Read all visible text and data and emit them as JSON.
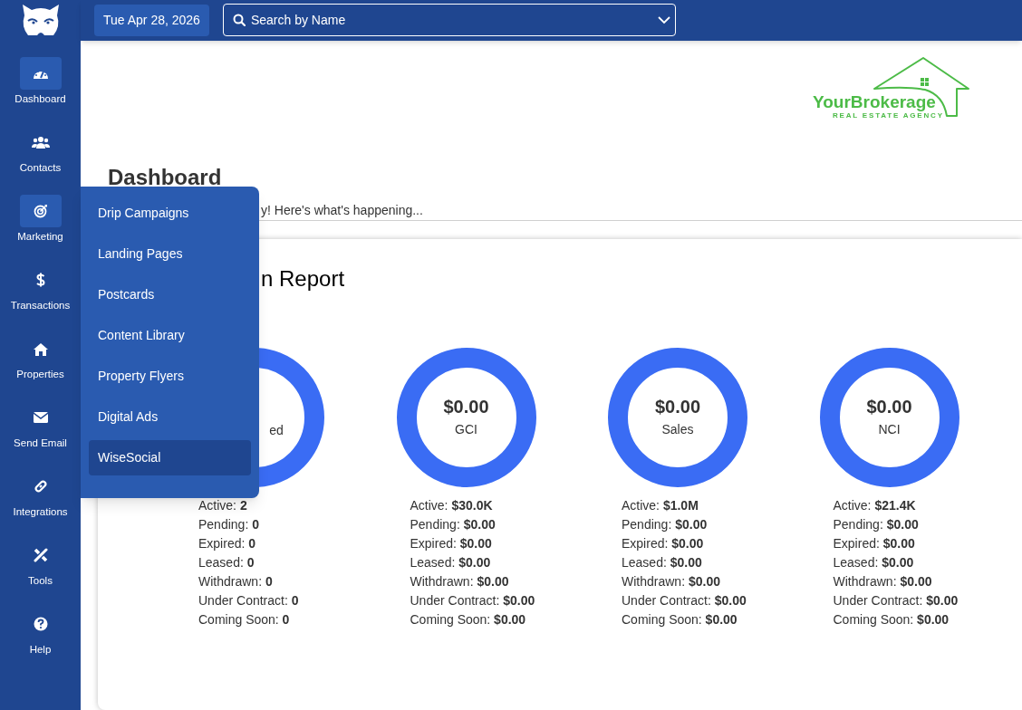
{
  "topbar": {
    "date": "Tue Apr 28, 2026",
    "search": {
      "placeholder": "Search by Name"
    }
  },
  "sidebar": {
    "items": [
      {
        "label": "Dashboard",
        "active": true
      },
      {
        "label": "Contacts",
        "active": false
      },
      {
        "label": "Marketing",
        "active": true
      },
      {
        "label": "Transactions",
        "active": false
      },
      {
        "label": "Properties",
        "active": false
      },
      {
        "label": "Send Email",
        "active": false
      },
      {
        "label": "Integrations",
        "active": false
      },
      {
        "label": "Tools",
        "active": false
      },
      {
        "label": "Help",
        "active": false
      }
    ]
  },
  "logo": {
    "name": "YourBrokerage",
    "tagline": "REAL ESTATE AGENCY"
  },
  "header": {
    "title": "Dashboard",
    "subtitle": "y! Here's what's happening..."
  },
  "report": {
    "title": "n Report",
    "cards": [
      {
        "label": "ed",
        "stats": [
          {
            "name": "Active:",
            "value": "2"
          },
          {
            "name": "Pending:",
            "value": "0"
          },
          {
            "name": "Expired:",
            "value": "0"
          },
          {
            "name": "Leased:",
            "value": "0"
          },
          {
            "name": "Withdrawn:",
            "value": "0"
          },
          {
            "name": "Under Contract:",
            "value": "0"
          },
          {
            "name": "Coming Soon:",
            "value": "0"
          }
        ]
      },
      {
        "value": "$0.00",
        "label": "GCI",
        "stats": [
          {
            "name": "Active:",
            "value": "$30.0K"
          },
          {
            "name": "Pending:",
            "value": "$0.00"
          },
          {
            "name": "Expired:",
            "value": "$0.00"
          },
          {
            "name": "Leased:",
            "value": "$0.00"
          },
          {
            "name": "Withdrawn:",
            "value": "$0.00"
          },
          {
            "name": "Under Contract:",
            "value": "$0.00"
          },
          {
            "name": "Coming Soon:",
            "value": "$0.00"
          }
        ]
      },
      {
        "value": "$0.00",
        "label": "Sales",
        "stats": [
          {
            "name": "Active:",
            "value": "$1.0M"
          },
          {
            "name": "Pending:",
            "value": "$0.00"
          },
          {
            "name": "Expired:",
            "value": "$0.00"
          },
          {
            "name": "Leased:",
            "value": "$0.00"
          },
          {
            "name": "Withdrawn:",
            "value": "$0.00"
          },
          {
            "name": "Under Contract:",
            "value": "$0.00"
          },
          {
            "name": "Coming Soon:",
            "value": "$0.00"
          }
        ]
      },
      {
        "value": "$0.00",
        "label": "NCI",
        "stats": [
          {
            "name": "Active:",
            "value": "$21.4K"
          },
          {
            "name": "Pending:",
            "value": "$0.00"
          },
          {
            "name": "Expired:",
            "value": "$0.00"
          },
          {
            "name": "Leased:",
            "value": "$0.00"
          },
          {
            "name": "Withdrawn:",
            "value": "$0.00"
          },
          {
            "name": "Under Contract:",
            "value": "$0.00"
          },
          {
            "name": "Coming Soon:",
            "value": "$0.00"
          }
        ]
      }
    ]
  },
  "marketing_menu": {
    "items": [
      {
        "label": "Drip Campaigns",
        "selected": false
      },
      {
        "label": "Landing Pages",
        "selected": false
      },
      {
        "label": "Postcards",
        "selected": false
      },
      {
        "label": "Content Library",
        "selected": false
      },
      {
        "label": "Property Flyers",
        "selected": false
      },
      {
        "label": "Digital Ads",
        "selected": false
      },
      {
        "label": "WiseSocial",
        "selected": true
      }
    ]
  }
}
